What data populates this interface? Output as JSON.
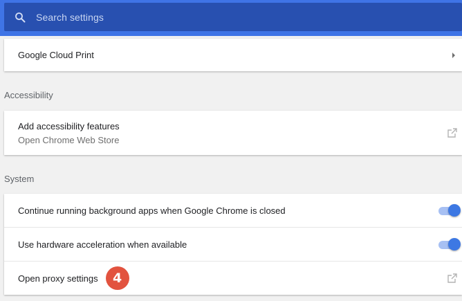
{
  "search": {
    "placeholder": "Search settings",
    "icon": "search-icon"
  },
  "cloud_print": {
    "label": "Google Cloud Print",
    "icon": "chevron-right-icon"
  },
  "accessibility": {
    "title": "Accessibility",
    "add_features": {
      "label": "Add accessibility features",
      "sublabel": "Open Chrome Web Store",
      "icon": "external-link-icon"
    }
  },
  "system": {
    "title": "System",
    "items": [
      {
        "label": "Continue running background apps when Google Chrome is closed",
        "toggle_on": true
      },
      {
        "label": "Use hardware acceleration when available",
        "toggle_on": true
      },
      {
        "label": "Open proxy settings",
        "badge": "4",
        "icon": "external-link-icon"
      }
    ]
  },
  "colors": {
    "header_blue": "#3f74e6",
    "search_box": "#2850b0",
    "toggle_on": "#3d78e3",
    "badge_red": "#e2533f"
  }
}
